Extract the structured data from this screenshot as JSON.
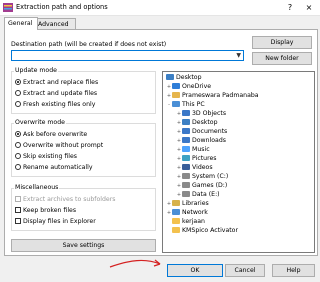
{
  "window": {
    "title": "Extraction path and options",
    "help_glyph": "?",
    "close_glyph": "×"
  },
  "tabs": [
    {
      "label": "General",
      "active": true
    },
    {
      "label": "Advanced",
      "active": false
    }
  ],
  "destination": {
    "label": "Destination path (will be created if does not exist)",
    "value": "",
    "display_button": "Display",
    "new_folder_button": "New folder"
  },
  "update_mode": {
    "title": "Update mode",
    "options": [
      {
        "label": "Extract and replace files",
        "selected": true
      },
      {
        "label": "Extract and update files",
        "selected": false
      },
      {
        "label": "Fresh existing files only",
        "selected": false
      }
    ]
  },
  "overwrite_mode": {
    "title": "Overwrite mode",
    "options": [
      {
        "label": "Ask before overwrite",
        "selected": true
      },
      {
        "label": "Overwrite without prompt",
        "selected": false
      },
      {
        "label": "Skip existing files",
        "selected": false
      },
      {
        "label": "Rename automatically",
        "selected": false
      }
    ]
  },
  "misc": {
    "title": "Miscellaneous",
    "options": [
      {
        "label": "Extract archives to subfolders",
        "checked": false,
        "disabled": true
      },
      {
        "label": "Keep broken files",
        "checked": false,
        "disabled": false
      },
      {
        "label": "Display files in Explorer",
        "checked": false,
        "disabled": false
      }
    ]
  },
  "save_settings": "Save settings",
  "tree": [
    {
      "label": "Desktop",
      "icon": "desktop-icon",
      "expander": ""
    },
    {
      "label": "OneDrive",
      "icon": "onedrive-icon",
      "expander": "+"
    },
    {
      "label": "Prameswara Padmanaba",
      "icon": "user-folder-icon",
      "expander": "+"
    },
    {
      "label": "This PC",
      "icon": "this-pc-icon",
      "expander": "-"
    },
    {
      "label": "3D Objects",
      "icon": "folder-3d-icon",
      "expander": "+"
    },
    {
      "label": "Desktop",
      "icon": "desktop-icon",
      "expander": "+"
    },
    {
      "label": "Documents",
      "icon": "documents-icon",
      "expander": "+"
    },
    {
      "label": "Downloads",
      "icon": "downloads-icon",
      "expander": "+"
    },
    {
      "label": "Music",
      "icon": "music-icon",
      "expander": "+"
    },
    {
      "label": "Pictures",
      "icon": "pictures-icon",
      "expander": "+"
    },
    {
      "label": "Videos",
      "icon": "videos-icon",
      "expander": "+"
    },
    {
      "label": "System (C:)",
      "icon": "drive-icon",
      "expander": "+"
    },
    {
      "label": "Games (D:)",
      "icon": "drive-icon",
      "expander": "+"
    },
    {
      "label": "Data (E:)",
      "icon": "drive-icon",
      "expander": "+"
    },
    {
      "label": "Libraries",
      "icon": "libraries-icon",
      "expander": "+"
    },
    {
      "label": "Network",
      "icon": "network-icon",
      "expander": "+"
    },
    {
      "label": "kerjaan",
      "icon": "folder-icon",
      "expander": ""
    },
    {
      "label": "KMSpico Activator",
      "icon": "folder-icon",
      "expander": ""
    }
  ],
  "footer": {
    "ok": "OK",
    "cancel": "Cancel",
    "help": "Help"
  },
  "colors": {
    "accent": "#0078d7",
    "annotation_arrow": "#d42020"
  }
}
